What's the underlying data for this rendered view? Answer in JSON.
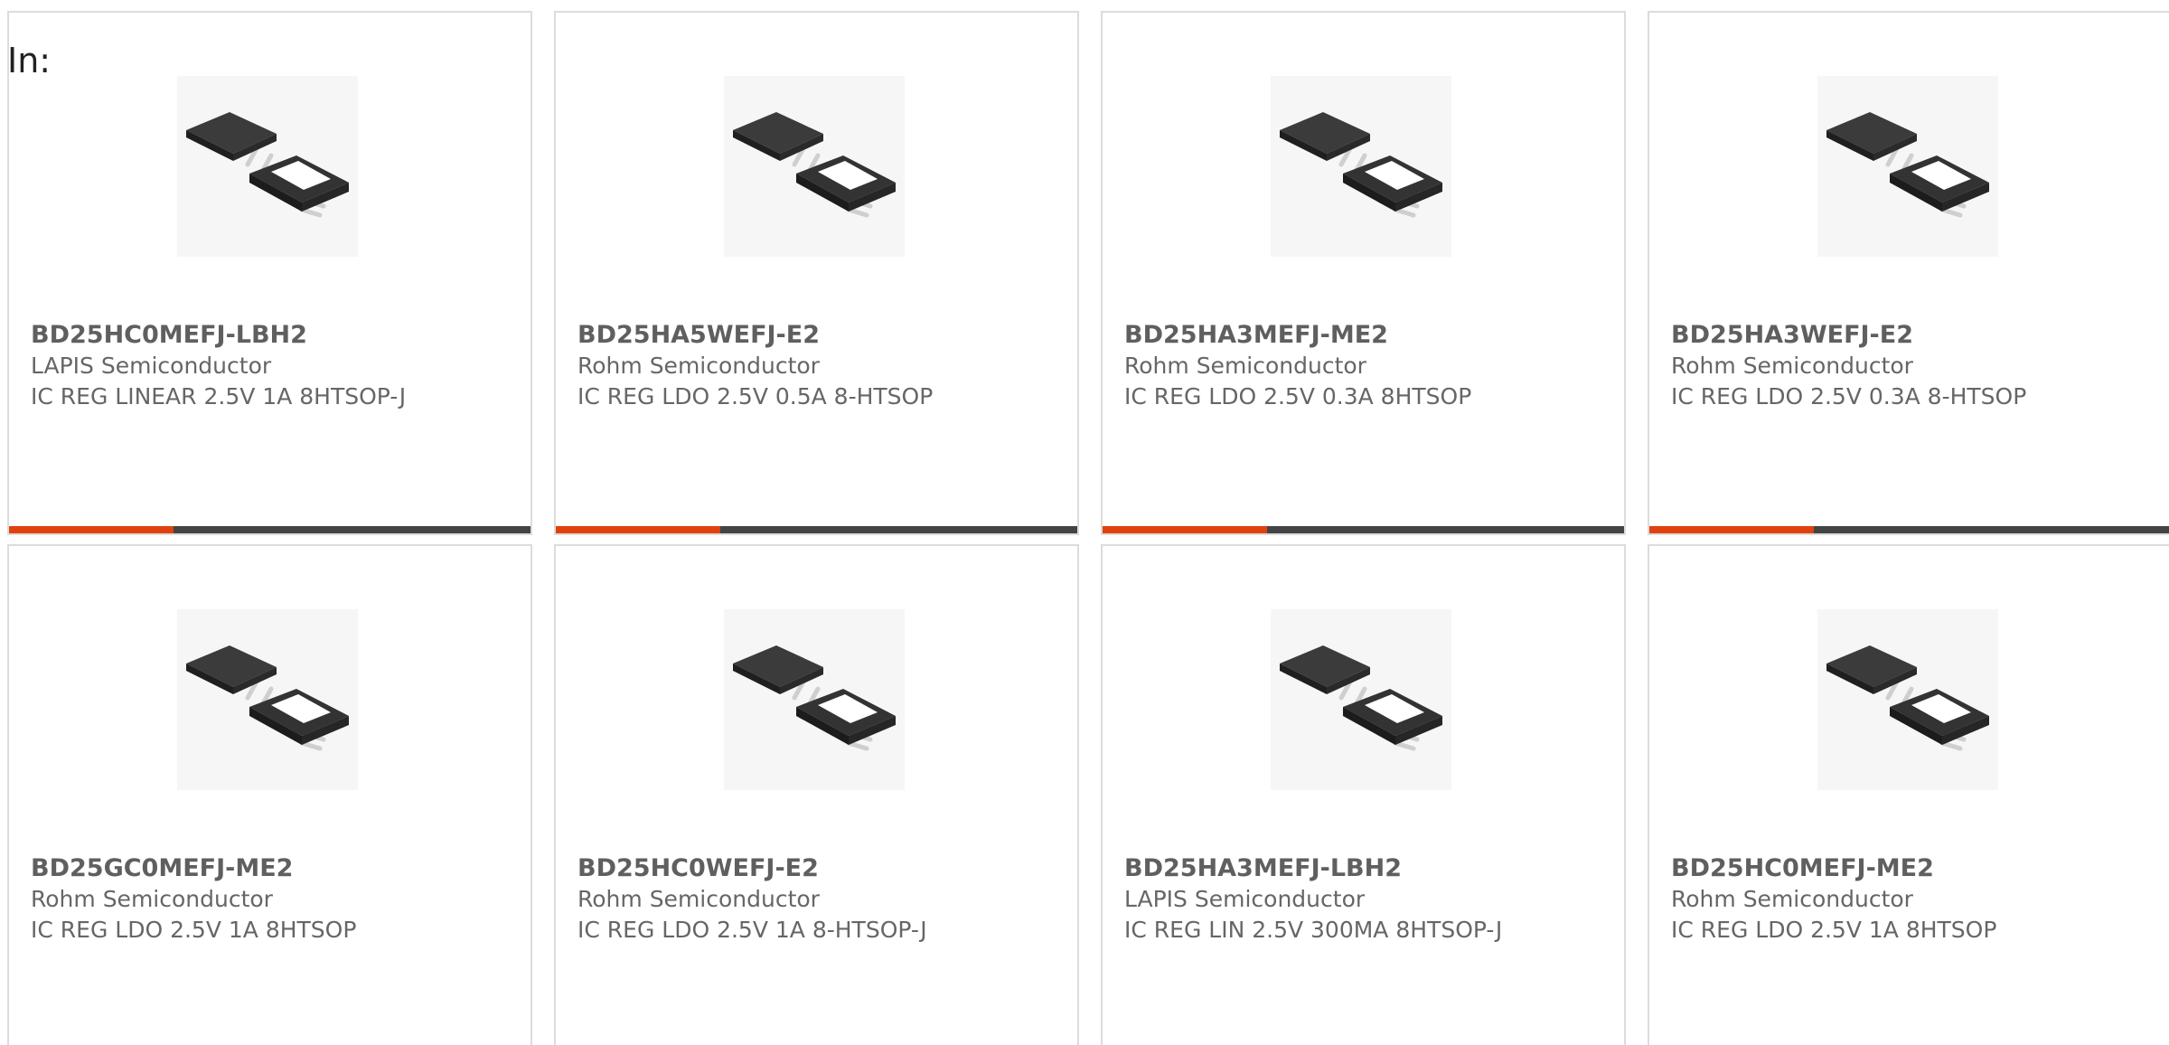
{
  "header": {
    "label": "In:"
  },
  "colors": {
    "accent": "#e0420f",
    "bar": "#444444",
    "border": "#dcdcdc"
  },
  "products": [
    {
      "part": "BD25HC0MEFJ-LBH2",
      "manufacturer": "LAPIS Semiconductor",
      "description": "IC REG LINEAR 2.5V 1A 8HTSOP-J",
      "image": "ic-chip-8htsop-image"
    },
    {
      "part": "BD25HA5WEFJ-E2",
      "manufacturer": "Rohm Semiconductor",
      "description": "IC REG LDO 2.5V 0.5A 8-HTSOP",
      "image": "ic-chip-8htsop-image"
    },
    {
      "part": "BD25HA3MEFJ-ME2",
      "manufacturer": "Rohm Semiconductor",
      "description": "IC REG LDO 2.5V 0.3A 8HTSOP",
      "image": "ic-chip-8htsop-image"
    },
    {
      "part": "BD25HA3WEFJ-E2",
      "manufacturer": "Rohm Semiconductor",
      "description": "IC REG LDO 2.5V 0.3A 8-HTSOP",
      "image": "ic-chip-8htsop-image"
    },
    {
      "part": "BD25GC0MEFJ-ME2",
      "manufacturer": "Rohm Semiconductor",
      "description": "IC REG LDO 2.5V 1A 8HTSOP",
      "image": "ic-chip-8htsop-image"
    },
    {
      "part": "BD25HC0WEFJ-E2",
      "manufacturer": "Rohm Semiconductor",
      "description": "IC REG LDO 2.5V 1A 8-HTSOP-J",
      "image": "ic-chip-8htsop-image"
    },
    {
      "part": "BD25HA3MEFJ-LBH2",
      "manufacturer": "LAPIS Semiconductor",
      "description": "IC REG LIN 2.5V 300MA 8HTSOP-J",
      "image": "ic-chip-8htsop-image"
    },
    {
      "part": "BD25HC0MEFJ-ME2",
      "manufacturer": "Rohm Semiconductor",
      "description": "IC REG LDO 2.5V 1A 8HTSOP",
      "image": "ic-chip-8htsop-image"
    }
  ]
}
